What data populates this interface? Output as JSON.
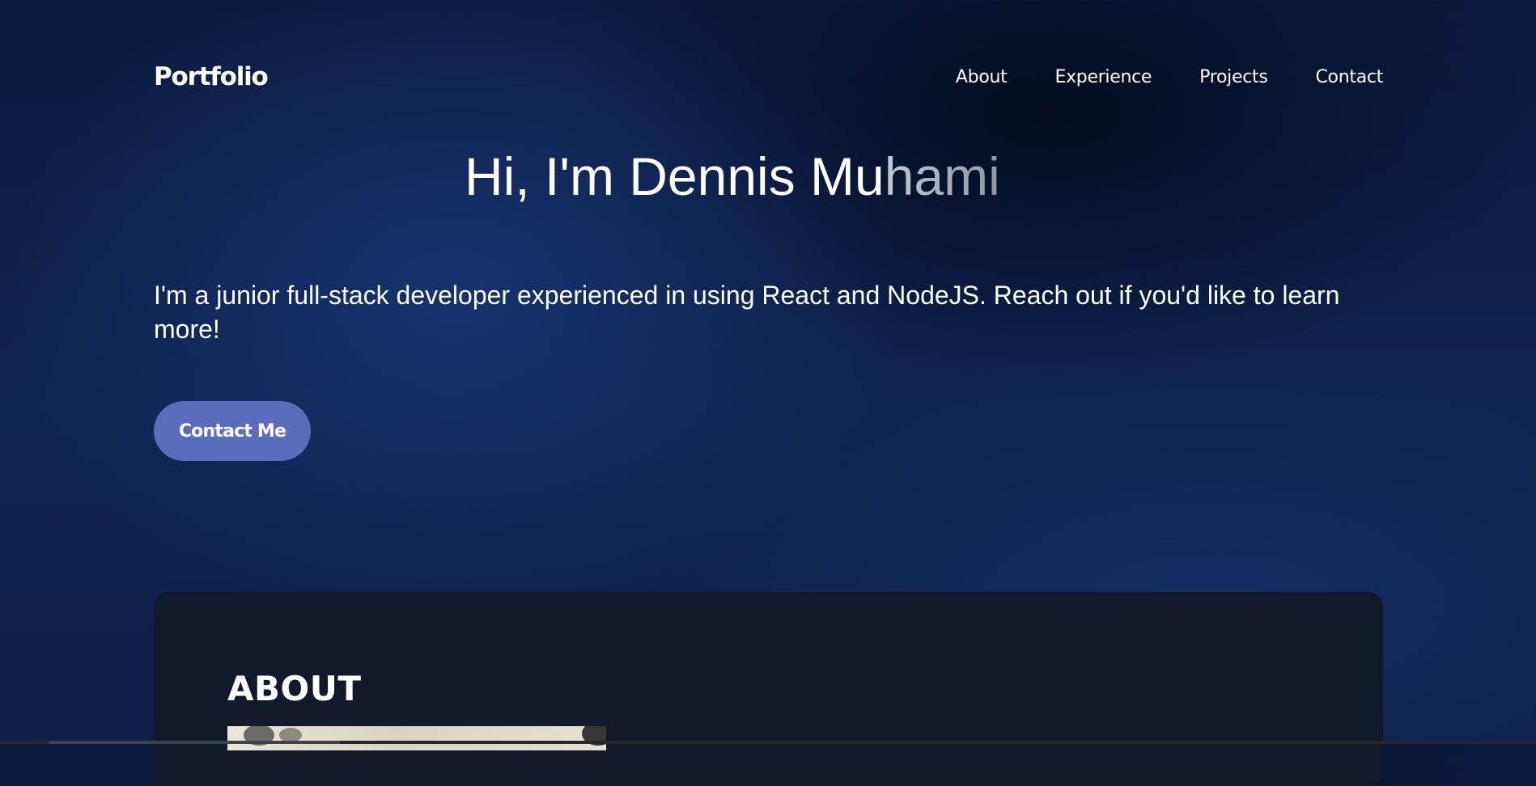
{
  "header": {
    "logo": "Portfolio",
    "nav": [
      "About",
      "Experience",
      "Projects",
      "Contact"
    ]
  },
  "hero": {
    "title_typed": "Hi, I'm Dennis Mu",
    "title_fading": "hami",
    "description": "I'm a junior full-stack developer experienced in using React and NodeJS. Reach out if you'd like to learn more!",
    "cta_label": "Contact Me"
  },
  "about": {
    "heading": "ABOUT"
  },
  "colors": {
    "background": "#0c1f47",
    "button": "#5a6dbd",
    "card": "#111a2b",
    "text": "#ffffff"
  }
}
